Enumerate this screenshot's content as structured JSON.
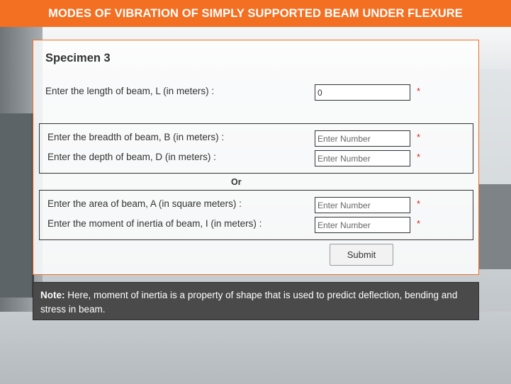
{
  "header": {
    "title": "MODES OF VIBRATION OF SIMPLY SUPPORTED BEAM UNDER FLEXURE"
  },
  "form": {
    "specimen_title": "Specimen 3",
    "length": {
      "label": "Enter the length of beam, L (in meters) :",
      "value": "0",
      "required_mark": "*"
    },
    "group1": {
      "breadth": {
        "label": "Enter the breadth of beam, B (in meters) :",
        "placeholder": "Enter Number",
        "required_mark": "*"
      },
      "depth": {
        "label": "Enter the depth of beam, D (in meters) :",
        "placeholder": "Enter Number",
        "required_mark": "*"
      }
    },
    "or_label": "Or",
    "group2": {
      "area": {
        "label": "Enter the area of beam, A (in square meters) :",
        "placeholder": "Enter Number",
        "required_mark": "*"
      },
      "inertia": {
        "label": "Enter the moment of inertia of beam, I (in meters) :",
        "placeholder": "Enter Number",
        "required_mark": "*"
      }
    },
    "submit_label": "Submit"
  },
  "note": {
    "prefix": "Note:",
    "text": " Here, moment of inertia is a property of shape that is used to predict deflection, bending and stress in beam."
  },
  "colors": {
    "accent": "#f36f21",
    "note_bg": "#4a4a4a",
    "required": "#e02020"
  }
}
